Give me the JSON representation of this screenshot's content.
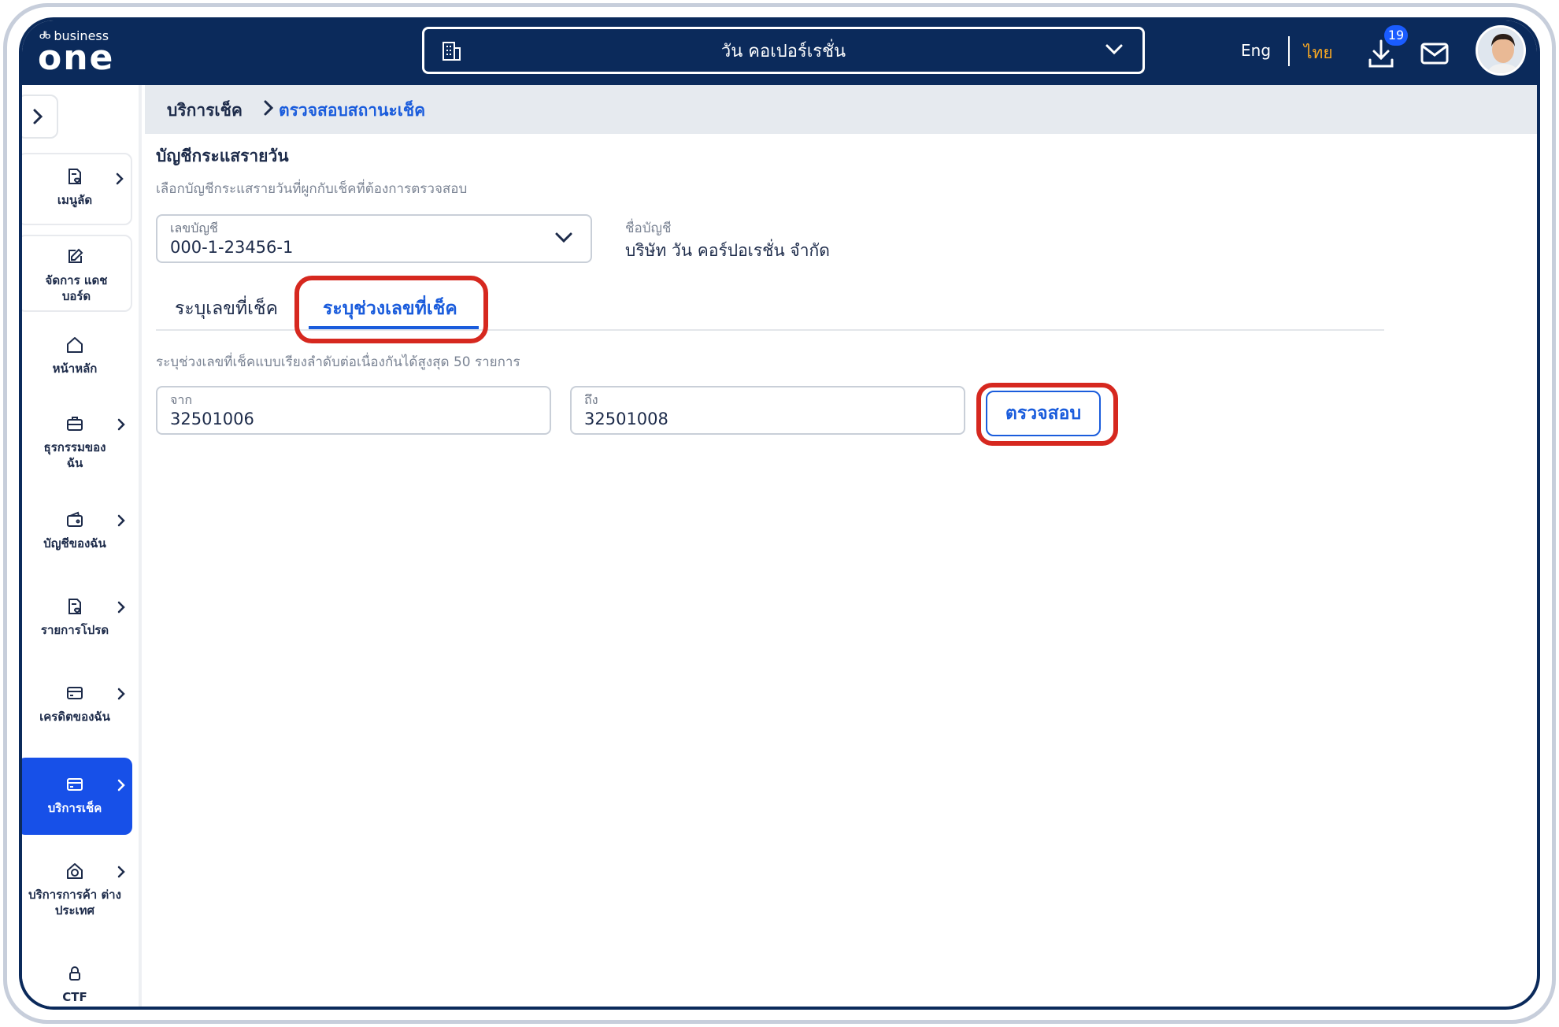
{
  "app": {
    "logo_small": "business",
    "logo_big": "one",
    "company_name": "วัน คอเปอร์เรชั่น",
    "lang_eng": "Eng",
    "lang_thai": "ไทย",
    "download_badge": "19"
  },
  "sidebar": {
    "items": [
      {
        "label": "เมนูลัด",
        "icon": "document-heart-icon",
        "has_arrow": true
      },
      {
        "label": "จัดการ แดชบอร์ด",
        "icon": "edit-icon",
        "has_arrow": false
      },
      {
        "label": "หน้าหลัก",
        "icon": "home-icon",
        "has_arrow": false
      },
      {
        "label": "ธุรกรรมของ ฉัน",
        "icon": "briefcase-icon",
        "has_arrow": true
      },
      {
        "label": "บัญชีของฉัน",
        "icon": "wallet-icon",
        "has_arrow": true
      },
      {
        "label": "รายการโปรด",
        "icon": "document-heart-icon",
        "has_arrow": true
      },
      {
        "label": "เครดิตของฉัน",
        "icon": "card-icon",
        "has_arrow": true
      },
      {
        "label": "บริการเช็ค",
        "icon": "card-icon",
        "has_arrow": true,
        "active": true
      },
      {
        "label": "บริการการค้า ต่างประเทศ",
        "icon": "globe-house-icon",
        "has_arrow": true
      },
      {
        "label": "CTF",
        "icon": "lock-icon",
        "has_arrow": false
      }
    ]
  },
  "breadcrumb": {
    "parent": "บริการเช็ค",
    "current": "ตรวจสอบสถานะเช็ค"
  },
  "account_section": {
    "title": "บัญชีกระแสรายวัน",
    "subtitle": "เลือกบัญชีกระแสรายวันที่ผูกกับเช็คที่ต้องการตรวจสอบ",
    "account_label": "เลขบัญชี",
    "account_value": "000-1-23456-1",
    "name_label": "ชื่อบัญชี",
    "name_value": "บริษัท วัน คอร์ปอเรชั่น จำกัด"
  },
  "tabs": {
    "tab1": "ระบุเลขที่เช็ค",
    "tab2": "ระบุช่วงเลขที่เช็ค",
    "active": "tab2"
  },
  "range": {
    "note": "ระบุช่วงเลขที่เช็คแบบเรียงลำดับต่อเนื่องกันได้สูงสุด 50 รายการ",
    "from_label": "จาก",
    "from_value": "32501006",
    "to_label": "ถึง",
    "to_value": "32501008",
    "check_button": "ตรวจสอบ"
  },
  "colors": {
    "navy": "#0b2a5b",
    "accent_blue": "#1a5cdc",
    "active_nav": "#1750e8",
    "highlight_red": "#d6281f",
    "thai_lang": "#f5a623"
  }
}
